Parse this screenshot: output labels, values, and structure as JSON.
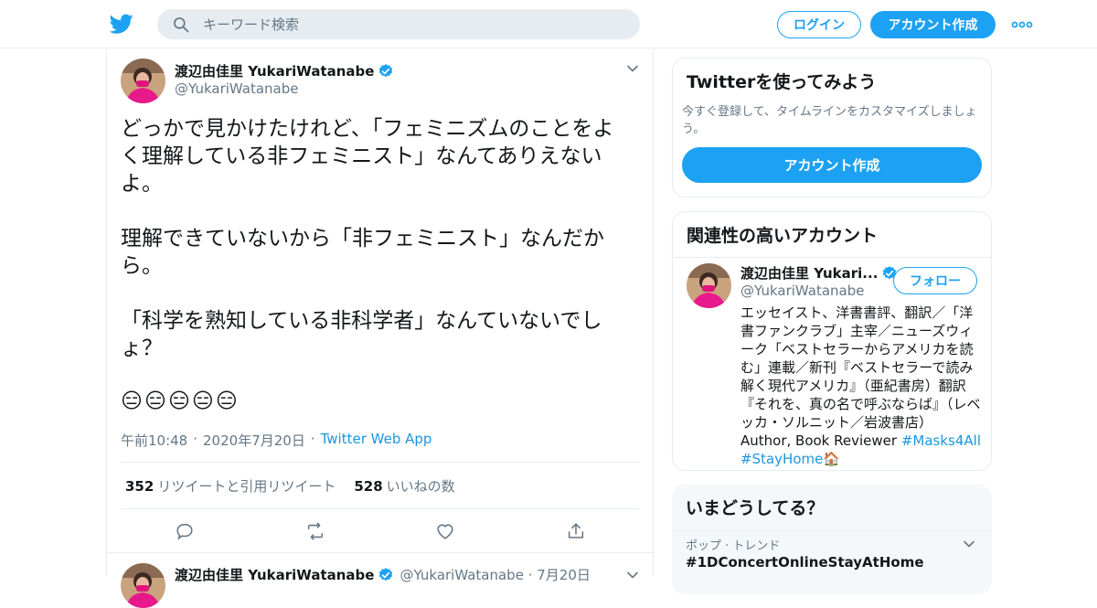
{
  "header": {
    "search_placeholder": "キーワード検索",
    "login_label": "ログイン",
    "signup_label": "アカウント作成"
  },
  "tweet": {
    "author_name": "渡辺由佳里 YukariWatanabe",
    "author_handle": "@YukariWatanabe",
    "text": "どっかで見かけたけれど、「フェミニズムのことをよく理解している非フェミニスト」なんてありえないよ。\n\n理解できていないから「非フェミニスト」なんだから。\n\n「科学を熟知している非科学者」なんていないでしょ？",
    "emoji": "😑😑😑😑😑",
    "time": "午前10:48",
    "date": "2020年7月20日",
    "app": "Twitter Web App",
    "retweets_count": "352",
    "retweets_label": "リツイートと引用リツイート",
    "likes_count": "528",
    "likes_label": "いいねの数"
  },
  "reply": {
    "author_name": "渡辺由佳里 YukariWatanabe",
    "author_handle": "@YukariWatanabe · 7月20日"
  },
  "signup_card": {
    "title": "Twitterを使ってみよう",
    "subtitle": "今すぐ登録して、タイムラインをカスタマイズしましょう。",
    "button_label": "アカウント作成"
  },
  "related_card": {
    "title": "関連性の高いアカウント",
    "name": "渡辺由佳里 Yukari...",
    "handle": "@YukariWatanabe",
    "follow_label": "フォロー",
    "bio": "エッセイスト、洋書書評、翻訳／「洋書ファンクラブ」主宰／ニューズウィーク「ベストセラーからアメリカを読む」連載／新刊『ベストセラーで読み解く現代アメリカ』（亜紀書房）翻訳『それを、真の名で呼ぶならば』（レベッカ・ソルニット／岩波書店）Author, Book Reviewer ",
    "tag1": "#Masks4All",
    "tag2": "#StayHome",
    "tag2_emoji": "🏠"
  },
  "trends_card": {
    "title": "いまどうしてる？",
    "trend_meta": "ポップ · トレンド",
    "trend_name": "#1DConcertOnlineStayAtHome"
  },
  "colors": {
    "brand_blue": "#1da1f2",
    "link_blue": "#1b95e0",
    "muted_text": "#657786",
    "border": "#e6ecf0"
  }
}
